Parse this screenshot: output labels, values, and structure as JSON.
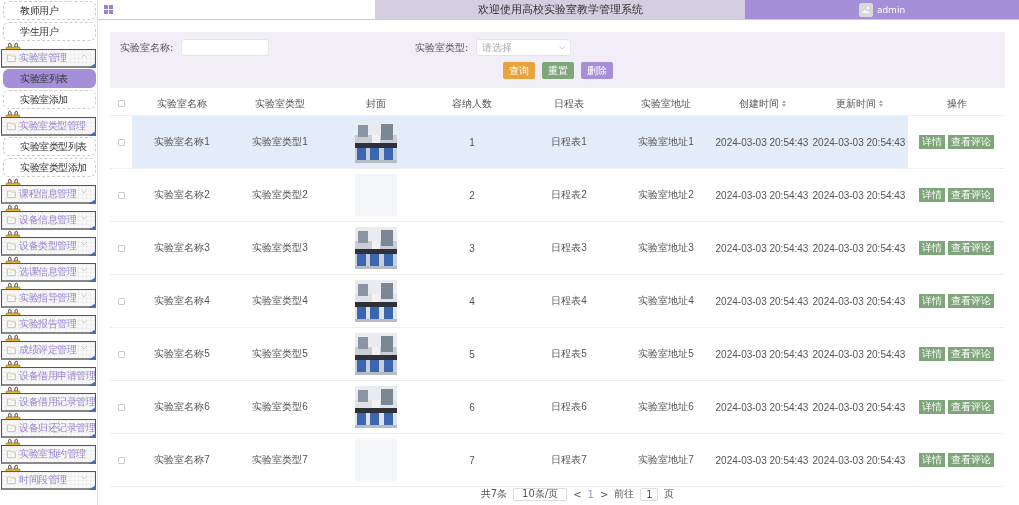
{
  "header": {
    "title": "欢迎使用高校实验室教学管理系统",
    "user": "admin"
  },
  "sidebar": {
    "items": [
      {
        "kind": "link",
        "label": "教师用户",
        "selected": false
      },
      {
        "kind": "link",
        "label": "学生用户",
        "selected": false
      },
      {
        "kind": "group",
        "label": "实验室管理",
        "expanded": true,
        "children": [
          {
            "label": "实验室列表",
            "selected": true
          },
          {
            "label": "实验室添加",
            "selected": false
          }
        ]
      },
      {
        "kind": "group",
        "label": "实验室类型管理",
        "expanded": true,
        "children": [
          {
            "label": "实验室类型列表",
            "selected": false
          },
          {
            "label": "实验室类型添加",
            "selected": false
          }
        ]
      },
      {
        "kind": "group",
        "label": "课程信息管理",
        "expanded": false
      },
      {
        "kind": "group",
        "label": "设备信息管理",
        "expanded": false
      },
      {
        "kind": "group",
        "label": "设备类型管理",
        "expanded": false
      },
      {
        "kind": "group",
        "label": "选课信息管理",
        "expanded": false
      },
      {
        "kind": "group",
        "label": "实验指导管理",
        "expanded": false
      },
      {
        "kind": "group",
        "label": "实验报告管理",
        "expanded": false
      },
      {
        "kind": "group",
        "label": "成绩评定管理",
        "expanded": false
      },
      {
        "kind": "group",
        "label": "设备借用申请管理",
        "expanded": false
      },
      {
        "kind": "group",
        "label": "设备借用记录管理",
        "expanded": false
      },
      {
        "kind": "group",
        "label": "设备归还记录管理",
        "expanded": false
      },
      {
        "kind": "group",
        "label": "实验室预约管理",
        "expanded": false
      },
      {
        "kind": "group",
        "label": "时间段管理",
        "expanded": false
      }
    ]
  },
  "search": {
    "fields": [
      {
        "kind": "input",
        "label": "实验室名称:"
      },
      {
        "kind": "select",
        "label": "实验室类型:",
        "placeholder": "请选择"
      }
    ],
    "buttons": [
      {
        "label": "查询",
        "color": "#e8a33a"
      },
      {
        "label": "重置",
        "color": "#7fa57a"
      },
      {
        "label": "删除",
        "color": "#a58fd8"
      }
    ]
  },
  "table": {
    "all_checked": false,
    "columns": [
      {
        "label": "实验室名称",
        "sortable": false
      },
      {
        "label": "实验室类型",
        "sortable": false
      },
      {
        "label": "封面",
        "sortable": false
      },
      {
        "label": "容纳人数",
        "sortable": false
      },
      {
        "label": "日程表",
        "sortable": false
      },
      {
        "label": "实验室地址",
        "sortable": false
      },
      {
        "label": "创建时间",
        "sortable": true
      },
      {
        "label": "更新时间",
        "sortable": true
      },
      {
        "label": "操作",
        "sortable": false
      }
    ],
    "rows": [
      {
        "highlighted": true,
        "checked": false,
        "name": "实验室名称1",
        "type": "实验室类型1",
        "cover": {
          "kind": "picture"
        },
        "capacity": "1",
        "schedule": "日程表1",
        "address": "实验室地址1",
        "created": "2024-03-03 20:54:43",
        "updated": "2024-03-03 20:54:43",
        "actions": [
          "详情",
          "查看评论"
        ]
      },
      {
        "highlighted": false,
        "checked": false,
        "name": "实验室名称2",
        "type": "实验室类型2",
        "cover": {
          "kind": "empty"
        },
        "capacity": "2",
        "schedule": "日程表2",
        "address": "实验室地址2",
        "created": "2024-03-03 20:54:43",
        "updated": "2024-03-03 20:54:43",
        "actions": [
          "详情",
          "查看评论"
        ]
      },
      {
        "highlighted": false,
        "checked": false,
        "name": "实验室名称3",
        "type": "实验室类型3",
        "cover": {
          "kind": "picture"
        },
        "capacity": "3",
        "schedule": "日程表3",
        "address": "实验室地址3",
        "created": "2024-03-03 20:54:43",
        "updated": "2024-03-03 20:54:43",
        "actions": [
          "详情",
          "查看评论"
        ]
      },
      {
        "highlighted": false,
        "checked": false,
        "name": "实验室名称4",
        "type": "实验室类型4",
        "cover": {
          "kind": "picture"
        },
        "capacity": "4",
        "schedule": "日程表4",
        "address": "实验室地址4",
        "created": "2024-03-03 20:54:43",
        "updated": "2024-03-03 20:54:43",
        "actions": [
          "详情",
          "查看评论"
        ]
      },
      {
        "highlighted": false,
        "checked": false,
        "name": "实验室名称5",
        "type": "实验室类型5",
        "cover": {
          "kind": "picture"
        },
        "capacity": "5",
        "schedule": "日程表5",
        "address": "实验室地址5",
        "created": "2024-03-03 20:54:43",
        "updated": "2024-03-03 20:54:43",
        "actions": [
          "详情",
          "查看评论"
        ]
      },
      {
        "highlighted": false,
        "checked": false,
        "name": "实验室名称6",
        "type": "实验室类型6",
        "cover": {
          "kind": "picture"
        },
        "capacity": "6",
        "schedule": "日程表6",
        "address": "实验室地址6",
        "created": "2024-03-03 20:54:43",
        "updated": "2024-03-03 20:54:43",
        "actions": [
          "详情",
          "查看评论"
        ]
      },
      {
        "highlighted": false,
        "checked": false,
        "name": "实验室名称7",
        "type": "实验室类型7",
        "cover": {
          "kind": "empty"
        },
        "capacity": "7",
        "schedule": "日程表7",
        "address": "实验室地址7",
        "created": "2024-03-03 20:54:43",
        "updated": "2024-03-03 20:54:43",
        "actions": [
          "详情",
          "查看评论"
        ]
      }
    ]
  },
  "pagination": {
    "total": "共7条",
    "page_size": "10条/页",
    "prev": "<",
    "pages": [
      {
        "label": "1",
        "selected": true
      }
    ],
    "next": ">",
    "goto": "前往",
    "goto_value": "1",
    "unit": "页"
  }
}
